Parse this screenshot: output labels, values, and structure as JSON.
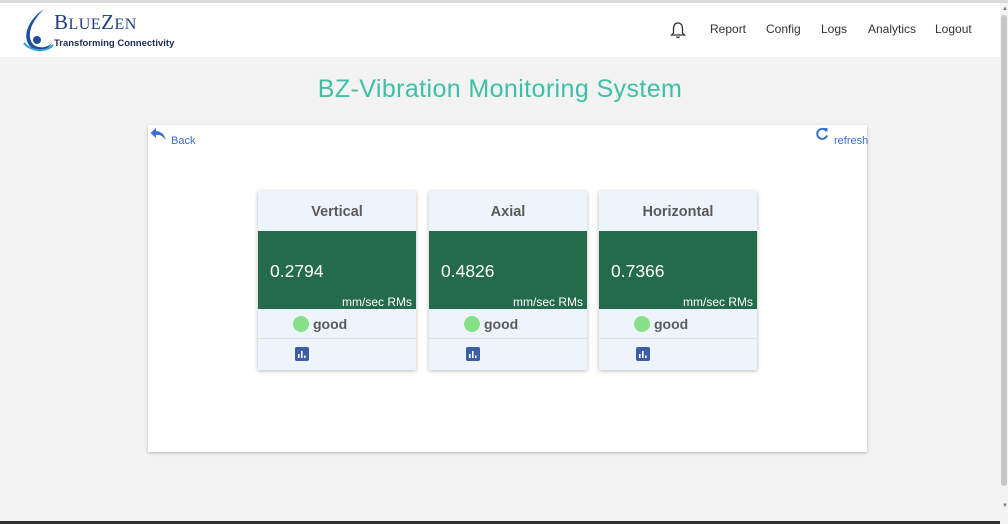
{
  "brand": {
    "name_first": "B",
    "name_rest": "LUE",
    "name_end": "Z",
    "name_tail": "EN",
    "tagline": "Transforming Connectivity",
    "color": "#1f3f7f"
  },
  "nav": {
    "bell_icon": "bell-icon",
    "links": [
      "Report",
      "Config",
      "Logs",
      "Analytics",
      "Logout"
    ]
  },
  "page": {
    "title": "BZ-Vibration Monitoring System",
    "title_color": "#3ebfa6"
  },
  "toolbar": {
    "back_label": "Back",
    "back_icon": "reply-arrow-icon",
    "refresh_label": "refresh",
    "refresh_icon": "refresh-icon"
  },
  "sensors": [
    {
      "axis": "Vertical",
      "value": "0.2794",
      "unit": "mm/sec RMs",
      "status": "good",
      "status_color": "#86e186",
      "chart_icon": "chart-icon"
    },
    {
      "axis": "Axial",
      "value": "0.4826",
      "unit": "mm/sec RMs",
      "status": "good",
      "status_color": "#86e186",
      "chart_icon": "chart-icon"
    },
    {
      "axis": "Horizontal",
      "value": "0.7366",
      "unit": "mm/sec RMs",
      "status": "good",
      "status_color": "#86e186",
      "chart_icon": "chart-icon"
    }
  ],
  "colors": {
    "value_panel": "#246b4b",
    "link": "#3a6fd6",
    "card_bg": "#eef4fb"
  }
}
